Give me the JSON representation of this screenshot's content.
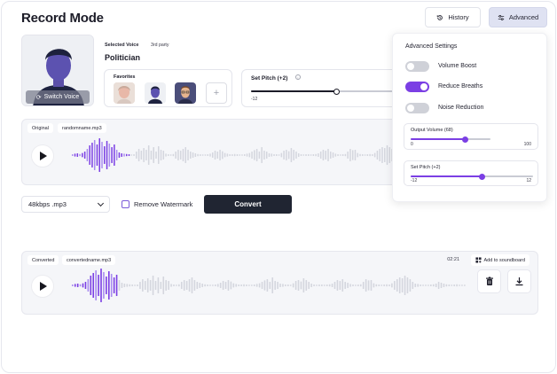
{
  "page_title": "Record Mode",
  "header": {
    "history_label": "History",
    "advanced_label": "Advanced"
  },
  "voice": {
    "switch_label": "Switch Voice",
    "selected_label": "Selected Voice",
    "source_tag": "3rd party",
    "name": "Politician",
    "favorites_label": "Favorites",
    "favorites_add_symbol": "+"
  },
  "pitch": {
    "label": "Set Pitch (+2)",
    "min_label": "-12",
    "value": 2,
    "min": -12,
    "max": 12
  },
  "original": {
    "tag": "Original",
    "filename": "randomname.mp3",
    "wave_bars": [
      0.05,
      0.08,
      0.1,
      0.06,
      0.12,
      0.2,
      0.35,
      0.55,
      0.7,
      0.85,
      0.6,
      0.95,
      0.75,
      0.5,
      0.8,
      0.65,
      0.45,
      0.6,
      0.3,
      0.15,
      0.1,
      0.08,
      0.06,
      0.05,
      0.04,
      0.05,
      0.2,
      0.35,
      0.25,
      0.4,
      0.3,
      0.55,
      0.25,
      0.45,
      0.2,
      0.5,
      0.3,
      0.25,
      0.08,
      0.05,
      0.04,
      0.06,
      0.2,
      0.3,
      0.25,
      0.35,
      0.45,
      0.3,
      0.2,
      0.15,
      0.1,
      0.06,
      0.05,
      0.04,
      0.03,
      0.05,
      0.08,
      0.15,
      0.25,
      0.2,
      0.3,
      0.22,
      0.12,
      0.08,
      0.05,
      0.05,
      0.06,
      0.05,
      0.04,
      0.04,
      0.05,
      0.08,
      0.12,
      0.2,
      0.28,
      0.35,
      0.2,
      0.45,
      0.25,
      0.2,
      0.1,
      0.08,
      0.05,
      0.05,
      0.04,
      0.12,
      0.25,
      0.3,
      0.22,
      0.4,
      0.3,
      0.2,
      0.1,
      0.05,
      0.04,
      0.05,
      0.05,
      0.04,
      0.05,
      0.06,
      0.1,
      0.2,
      0.3,
      0.25,
      0.35,
      0.2,
      0.15,
      0.08,
      0.05,
      0.04,
      0.05,
      0.06,
      0.2,
      0.35,
      0.28,
      0.3,
      0.12,
      0.06,
      0.05,
      0.04,
      0.05,
      0.06,
      0.05,
      0.12,
      0.25,
      0.35,
      0.45,
      0.4,
      0.55,
      0.45,
      0.35,
      0.2,
      0.1,
      0.08,
      0.05,
      0.04,
      0.03,
      0.04,
      0.05,
      0.06
    ],
    "played_fraction": 0.17
  },
  "controls": {
    "format": "48kbps .mp3",
    "watermark_label": "Remove Watermark",
    "convert_label": "Convert"
  },
  "converted": {
    "tag": "Converted",
    "filename": "convertedname.mp3",
    "timestamp": "02:21",
    "soundboard_label": "Add to soundboard",
    "wave_bars": [
      0.05,
      0.08,
      0.1,
      0.06,
      0.12,
      0.2,
      0.35,
      0.55,
      0.7,
      0.85,
      0.6,
      0.95,
      0.75,
      0.5,
      0.8,
      0.65,
      0.45,
      0.6,
      0.3,
      0.15,
      0.1,
      0.08,
      0.06,
      0.05,
      0.04,
      0.05,
      0.2,
      0.35,
      0.25,
      0.4,
      0.3,
      0.55,
      0.25,
      0.45,
      0.2,
      0.5,
      0.3,
      0.25,
      0.08,
      0.05,
      0.04,
      0.06,
      0.2,
      0.3,
      0.25,
      0.35,
      0.45,
      0.3,
      0.2,
      0.15,
      0.1,
      0.06,
      0.05,
      0.04,
      0.03,
      0.05,
      0.08,
      0.15,
      0.25,
      0.2,
      0.3,
      0.22,
      0.12,
      0.08,
      0.05,
      0.05,
      0.06,
      0.05,
      0.04,
      0.04,
      0.05,
      0.08,
      0.12,
      0.2,
      0.28,
      0.35,
      0.2,
      0.45,
      0.25,
      0.2,
      0.1,
      0.08,
      0.05,
      0.05,
      0.04,
      0.12,
      0.25,
      0.3,
      0.22,
      0.4,
      0.3,
      0.2,
      0.1,
      0.05,
      0.04,
      0.05,
      0.05,
      0.04,
      0.05,
      0.06,
      0.1,
      0.2,
      0.3,
      0.25,
      0.35,
      0.2,
      0.15,
      0.08,
      0.05,
      0.04,
      0.05,
      0.06,
      0.2,
      0.35,
      0.28,
      0.3,
      0.12,
      0.06,
      0.05,
      0.04,
      0.05,
      0.06,
      0.05,
      0.12,
      0.25,
      0.35,
      0.45,
      0.4,
      0.55,
      0.45,
      0.35,
      0.2,
      0.1,
      0.08,
      0.05,
      0.04,
      0.03,
      0.04,
      0.05,
      0.06,
      0.1,
      0.2,
      0.15,
      0.1,
      0.06,
      0.05,
      0.04,
      0.05,
      0.06,
      0.04,
      0.03,
      0.04
    ],
    "played_fraction": 0.12
  },
  "advanced": {
    "title": "Advanced Settings",
    "toggles": [
      {
        "label": "Volume Boost",
        "on": false
      },
      {
        "label": "Reduce Breaths",
        "on": true
      },
      {
        "label": "Noise Reduction",
        "on": false
      }
    ],
    "output_volume": {
      "label": "Output Volume (68)",
      "min_label": "0",
      "max_label": "100",
      "value": 68,
      "min": 0,
      "max": 100
    },
    "pitch": {
      "label": "Set Pitch (+2)",
      "min_label": "-12",
      "max_label": "12",
      "value": 2,
      "min": -12,
      "max": 12
    }
  },
  "colors": {
    "accent": "#7b3fe4",
    "accent_light": "#a98cf0",
    "wave_idle": "#d4d6de",
    "dark_button": "#202532",
    "toggle_off": "#cfd1d8"
  }
}
